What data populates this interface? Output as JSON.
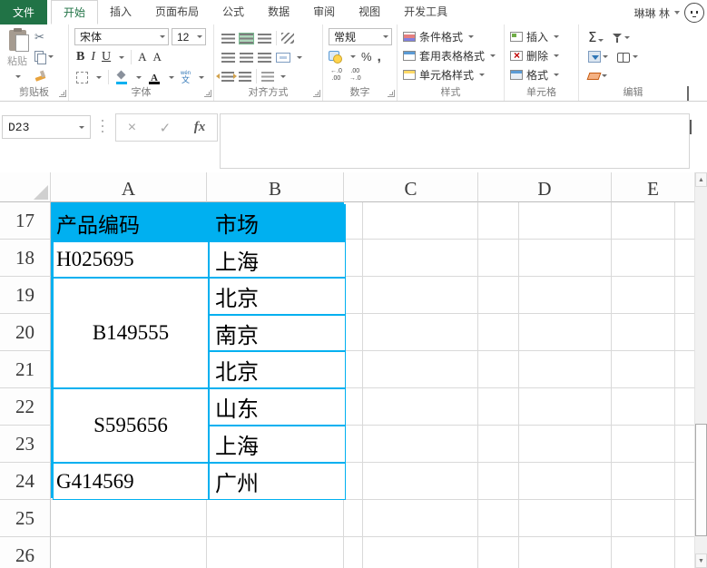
{
  "tabs": {
    "file": "文件",
    "home": "开始",
    "insert": "插入",
    "page_layout": "页面布局",
    "formulas": "公式",
    "data": "数据",
    "review": "审阅",
    "view": "视图",
    "developer": "开发工具"
  },
  "user": {
    "name": "琳琳 林"
  },
  "ribbon": {
    "clipboard": {
      "group_label": "剪贴板",
      "paste_label": "粘贴"
    },
    "font": {
      "group_label": "字体",
      "font_name": "宋体",
      "font_size": "12",
      "bold": "B",
      "italic": "I",
      "underline": "U",
      "grow": "A",
      "shrink": "A",
      "fontcolor_letter": "A",
      "phonetic_py": "wén",
      "phonetic_zh": "文"
    },
    "alignment": {
      "group_label": "对齐方式"
    },
    "number": {
      "group_label": "数字",
      "format": "常规",
      "percent": "%",
      "comma": ",",
      "inc_decimal": "←.0\n.00",
      "dec_decimal": ".00\n→.0"
    },
    "styles": {
      "group_label": "样式",
      "conditional": "条件格式",
      "format_as_table": "套用表格格式",
      "cell_styles": "单元格样式"
    },
    "cells": {
      "group_label": "单元格",
      "insert": "插入",
      "delete": "删除",
      "format": "格式"
    },
    "editing": {
      "group_label": "编辑",
      "sigma": "Σ"
    }
  },
  "formula_bar": {
    "name_box": "D23",
    "cancel_icon": "×",
    "enter_icon": "✓",
    "fx_icon": "fx",
    "formula_value": ""
  },
  "grid": {
    "columns": [
      "A",
      "B",
      "C",
      "D",
      "E"
    ],
    "row_numbers": [
      "17",
      "18",
      "19",
      "20",
      "21",
      "22",
      "23",
      "24",
      "25",
      "26"
    ],
    "cells": {
      "a17": "产品编码",
      "b17": "市场",
      "a18": "H025695",
      "b18": "上海",
      "a19_21": "B149555",
      "b19": "北京",
      "b20": "南京",
      "b21": "北京",
      "a22_23": "S595656",
      "b22": "山东",
      "b23": "上海",
      "a24": "G414569",
      "b24": "广州"
    }
  },
  "colors": {
    "header_fill": "#00B0F0",
    "brand_green": "#217346",
    "table_border": "#00B0F0"
  }
}
